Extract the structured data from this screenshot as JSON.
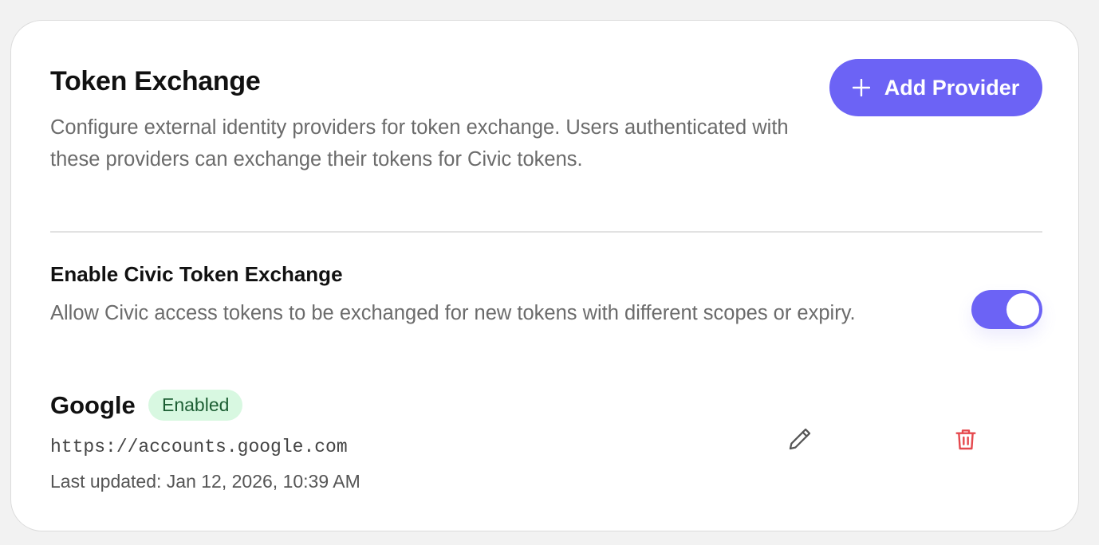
{
  "section": {
    "title": "Token Exchange",
    "description": "Configure external identity providers for token exchange. Users authenticated with these providers can exchange their tokens for Civic tokens.",
    "add_button_label": "Add Provider"
  },
  "civic_exchange": {
    "title": "Enable Civic Token Exchange",
    "description": "Allow Civic access tokens to be exchanged for new tokens with different scopes or expiry.",
    "enabled": true
  },
  "providers": [
    {
      "name": "Google",
      "status": "Enabled",
      "url": "https://accounts.google.com",
      "last_updated": "Last updated: Jan 12, 2026, 10:39 AM",
      "icons": [
        "pencil-icon",
        "trash-icon"
      ]
    }
  ],
  "colors": {
    "accent": "#6c63f5",
    "badge_bg": "#d8f8e1",
    "badge_text": "#1c5e33",
    "danger": "#e5484d",
    "muted_text": "#6b6b6b"
  }
}
